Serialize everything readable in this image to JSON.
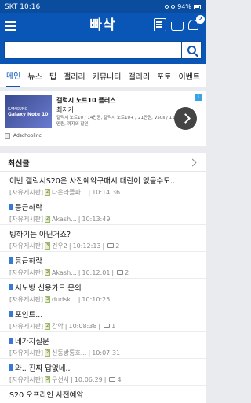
{
  "status_bar": {
    "carrier": "SKT",
    "time": "10:16",
    "battery": "94%"
  },
  "app": {
    "logo": "빠삭",
    "notification_count": "2"
  },
  "search": {
    "placeholder": "",
    "value": ""
  },
  "tabs": [
    "메인",
    "뉴스",
    "팁",
    "갤러리",
    "커뮤니티",
    "갤러리",
    "포토",
    "이벤트"
  ],
  "ad": {
    "brand": "SAMSUNG",
    "model": "Galaxy Note 10",
    "title": "갤럭시 노트10 플러스",
    "subtitle": "최저가",
    "description": "갤럭시 노트10 / 14만원, 갤럭시 노트10+ / 21만원, V50s / 11만원, 까지의 할인",
    "source": "Adschoolinc",
    "mark": "i"
  },
  "recent": {
    "heading": "최신글",
    "posts": [
      {
        "title": "이번 갤럭시S20은 사전예약구매시 대란이 없을수도...",
        "board": "[자유게시판]",
        "level": "2",
        "author": "다은라플파...",
        "time": "10:14:36",
        "comments": "",
        "new": false
      },
      {
        "title": "등급하락",
        "board": "[자유게시판]",
        "level": "2",
        "author": "Akash...",
        "time": "10:13:49",
        "comments": "",
        "new": true
      },
      {
        "title": "빙하기는 아닌거죠?",
        "board": "[자유게시판]",
        "level": "3",
        "author": "건우2",
        "time": "10:12:13",
        "comments": "2",
        "new": false
      },
      {
        "title": "등급하락",
        "board": "[자유게시판]",
        "level": "2",
        "author": "Akash...",
        "time": "10:12:01",
        "comments": "2",
        "new": true
      },
      {
        "title": "시노방 신용카드 문의",
        "board": "[자유게시판]",
        "level": "3",
        "author": "dudsk...",
        "time": "10:10:25",
        "comments": "",
        "new": true
      },
      {
        "title": "포인트...",
        "board": "[자유게시판]",
        "level": "2",
        "author": "감악",
        "time": "10:08:38",
        "comments": "1",
        "new": true
      },
      {
        "title": "네가지질문",
        "board": "[자유게시판]",
        "level": "2",
        "author": "신동방통호...",
        "time": "10:07:31",
        "comments": "",
        "new": true
      },
      {
        "title": "와.. 진짜 답없네..",
        "board": "[자유게시판]",
        "level": "2",
        "author": "우선사",
        "time": "10:06:29",
        "comments": "4",
        "new": true
      },
      {
        "title": "S20 오프라인 사전예약",
        "board": "",
        "level": "",
        "author": "",
        "time": "",
        "comments": "",
        "new": false
      }
    ]
  }
}
